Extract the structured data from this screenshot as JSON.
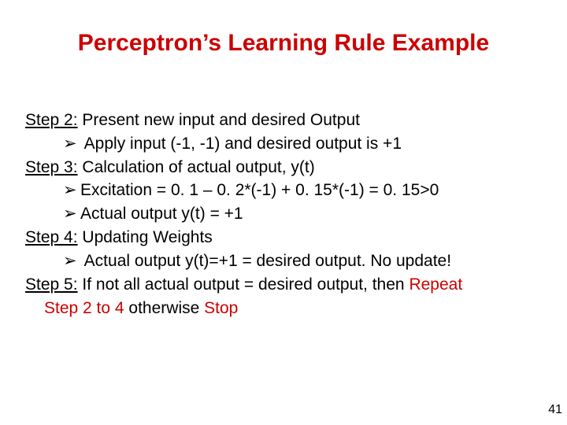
{
  "title": "Perceptron’s Learning Rule Example",
  "body": {
    "step2_label": "Step 2:",
    "step2_rest": " Present new input and desired Output",
    "step2_sub": " Apply input (-1, -1) and desired output is +1",
    "step3_label": "Step 3:",
    "step3_rest": " Calculation of actual output, y(t)",
    "step3_sub1": "Excitation = 0. 1 – 0. 2*(-1) + 0. 15*(-1) = 0. 15>0",
    "step3_sub2": "Actual output y(t) = +1",
    "step4_label": "Step 4:",
    "step4_rest": " Updating Weights",
    "step4_sub": " Actual output y(t)=+1 = desired output. No update!",
    "step5_label": "Step 5:",
    "step5_a": " If not all actual output = desired output, then ",
    "step5_repeat": "Repeat",
    "step5_b": "Step 2 to 4",
    "step5_c": " otherwise ",
    "step5_stop": "Stop"
  },
  "glyph": {
    "arrow": "➢"
  },
  "page_number": "41"
}
